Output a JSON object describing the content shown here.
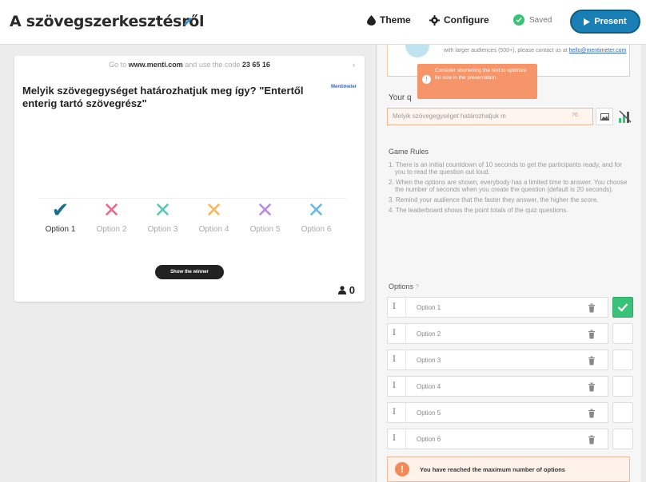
{
  "header": {
    "title": "A szövegszerkesztésről",
    "theme_label": "Theme",
    "configure_label": "Configure",
    "saved_label": "Saved",
    "present_label": "Present"
  },
  "preview": {
    "code_prefix": "Go to",
    "code_site": "www.menti.com",
    "code_middle": "and use the code",
    "code_value": "23 65 16",
    "question": "Melyik szövegegységet határozhatjuk meg így? \"Entertől enterig tartó szövegrész\"",
    "brand_tag": "Mentimeter",
    "options": [
      {
        "label": "Option 1",
        "mark": "check",
        "color": "#1a6f8c"
      },
      {
        "label": "Option 2",
        "mark": "cross",
        "color": "#e56b8a"
      },
      {
        "label": "Option 3",
        "mark": "cross",
        "color": "#5cc6b0"
      },
      {
        "label": "Option 4",
        "mark": "cross",
        "color": "#f5b860"
      },
      {
        "label": "Option 5",
        "mark": "cross",
        "color": "#b98bd6"
      },
      {
        "label": "Option 6",
        "mark": "cross",
        "color": "#6cb8dd"
      }
    ],
    "show_winner_label": "Show the winner",
    "respondent_count": "0"
  },
  "panel": {
    "card_text": "with larger audiences (500+), please contact us at",
    "card_link": "hello@mentimeter.com",
    "tooltip_text": "Consider shortening the text to optimize for size in the presentation.",
    "your_question_label": "Your q",
    "question_value": "Melyik szövegegységet határozhatjuk m",
    "char_count": "76",
    "game_rules_title": "Game Rules",
    "game_rules": [
      "1. There is an initial countdown of 10 seconds to get the participants ready, and for you to read the question out loud.",
      "2. When the options are shown, everybody has a limited time to answer. You choose the number of seconds when you create the question (default is 20 seconds).",
      "3. Remind your audience that the faster they answer, the higher the score.",
      "4. The leaderboard shows the point totals of the quiz questions."
    ],
    "options_title": "Options",
    "options_help": "?",
    "options": [
      {
        "value": "Option 1",
        "correct": true
      },
      {
        "value": "Option 2",
        "correct": false
      },
      {
        "value": "Option 3",
        "correct": false
      },
      {
        "value": "Option 4",
        "correct": false
      },
      {
        "value": "Option 5",
        "correct": false
      },
      {
        "value": "Option 6",
        "correct": false
      }
    ],
    "max_options_text": "You have reached the maximum number of options"
  }
}
